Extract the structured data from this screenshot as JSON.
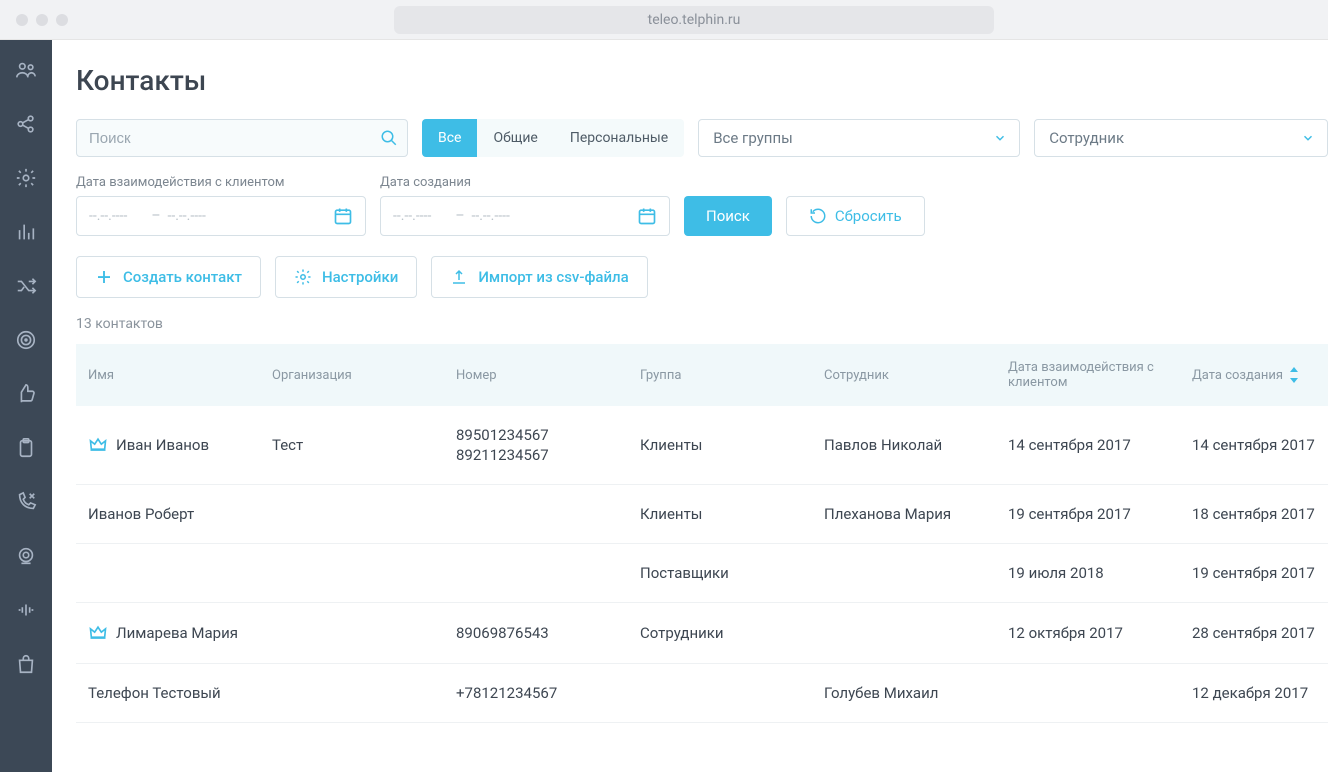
{
  "url": "teleo.telphin.ru",
  "page_title": "Контакты",
  "search": {
    "placeholder": "Поиск"
  },
  "scope_tabs": {
    "all": "Все",
    "shared": "Общие",
    "personal": "Персональные"
  },
  "group_select": {
    "label": "Все группы"
  },
  "employee_select": {
    "label": "Сотрудник"
  },
  "date_interaction": {
    "label": "Дата взаимодействия с клиентом",
    "from": "--.--.----",
    "sep": "–",
    "to": "--.--.----"
  },
  "date_created": {
    "label": "Дата создания",
    "from": "--.--.----",
    "sep": "–",
    "to": "--.--.----"
  },
  "buttons": {
    "search": "Поиск",
    "reset": "Сбросить",
    "create": "Создать контакт",
    "settings": "Настройки",
    "import": "Импорт из csv-файла"
  },
  "count_text": "13 контактов",
  "columns": {
    "name": "Имя",
    "org": "Организация",
    "number": "Номер",
    "group": "Группа",
    "employee": "Сотрудник",
    "interaction": "Дата взаимодействия с клиентом",
    "created": "Дата создания"
  },
  "rows": [
    {
      "crown": true,
      "name": "Иван Иванов",
      "org": "Тест",
      "numbers": [
        "89501234567",
        "89211234567"
      ],
      "group": "Клиенты",
      "employee": "Павлов Николай",
      "interaction": "14 сентября 2017",
      "created": "14 сентября 2017"
    },
    {
      "crown": false,
      "name": "Иванов Роберт",
      "org": "",
      "numbers": [],
      "group": "Клиенты",
      "employee": "Плеханова Мария",
      "interaction": "19 сентября 2017",
      "created": "18 сентября 2017"
    },
    {
      "crown": false,
      "name": "",
      "org": "",
      "numbers": [],
      "group": "Поставщики",
      "employee": "",
      "interaction": "19 июля 2018",
      "created": "19 сентября 2017"
    },
    {
      "crown": true,
      "name": "Лимарева Мария",
      "org": "",
      "numbers": [
        "89069876543"
      ],
      "group": "Сотрудники",
      "employee": "",
      "interaction": "12 октября 2017",
      "created": "28 сентября 2017"
    },
    {
      "crown": false,
      "name": "Телефон Тестовый",
      "org": "",
      "numbers": [
        "+78121234567"
      ],
      "group": "",
      "employee": "Голубев Михаил",
      "interaction": "",
      "created": "12 декабря 2017"
    }
  ]
}
